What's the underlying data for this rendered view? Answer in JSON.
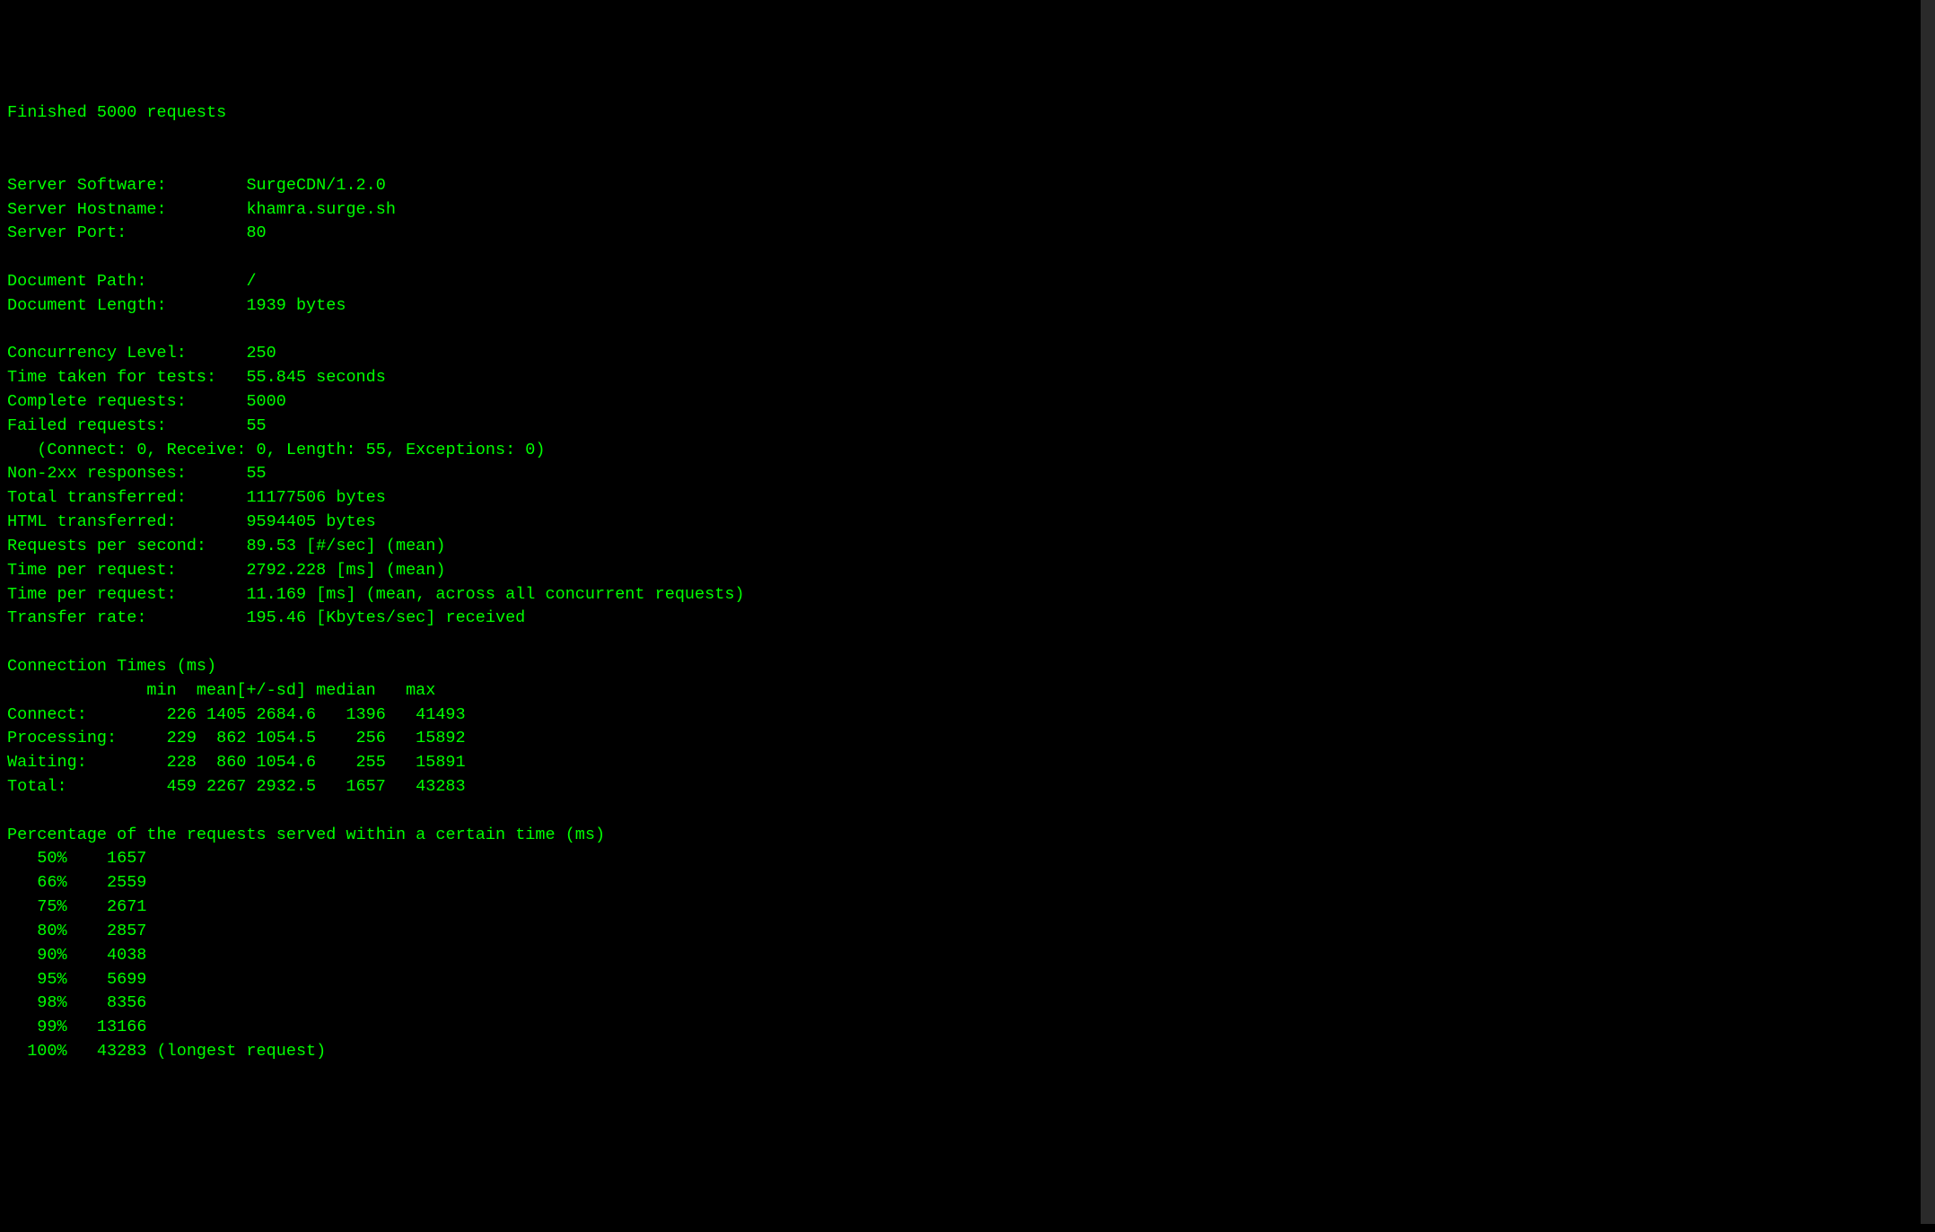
{
  "header": {
    "finished_line": "Finished 5000 requests"
  },
  "server": {
    "software_label": "Server Software:",
    "software_value": "SurgeCDN/1.2.0",
    "hostname_label": "Server Hostname:",
    "hostname_value": "khamra.surge.sh",
    "port_label": "Server Port:",
    "port_value": "80"
  },
  "document": {
    "path_label": "Document Path:",
    "path_value": "/",
    "length_label": "Document Length:",
    "length_value": "1939 bytes"
  },
  "stats": {
    "concurrency_label": "Concurrency Level:",
    "concurrency_value": "250",
    "time_taken_label": "Time taken for tests:",
    "time_taken_value": "55.845 seconds",
    "complete_label": "Complete requests:",
    "complete_value": "5000",
    "failed_label": "Failed requests:",
    "failed_value": "55",
    "failed_breakdown": "   (Connect: 0, Receive: 0, Length: 55, Exceptions: 0)",
    "non2xx_label": "Non-2xx responses:",
    "non2xx_value": "55",
    "total_transferred_label": "Total transferred:",
    "total_transferred_value": "11177506 bytes",
    "html_transferred_label": "HTML transferred:",
    "html_transferred_value": "9594405 bytes",
    "rps_label": "Requests per second:",
    "rps_value": "89.53 [#/sec] (mean)",
    "tpr1_label": "Time per request:",
    "tpr1_value": "2792.228 [ms] (mean)",
    "tpr2_label": "Time per request:",
    "tpr2_value": "11.169 [ms] (mean, across all concurrent requests)",
    "transfer_rate_label": "Transfer rate:",
    "transfer_rate_value": "195.46 [Kbytes/sec] received"
  },
  "connection_times": {
    "heading": "Connection Times (ms)",
    "header_row": "              min  mean[+/-sd] median   max",
    "rows": [
      {
        "name": "Connect:",
        "min": "226",
        "mean": "1405",
        "sd": "2684.6",
        "median": "1396",
        "max": "41493"
      },
      {
        "name": "Processing:",
        "min": "229",
        "mean": "862",
        "sd": "1054.5",
        "median": "256",
        "max": "15892"
      },
      {
        "name": "Waiting:",
        "min": "228",
        "mean": "860",
        "sd": "1054.6",
        "median": "255",
        "max": "15891"
      },
      {
        "name": "Total:",
        "min": "459",
        "mean": "2267",
        "sd": "2932.5",
        "median": "1657",
        "max": "43283"
      }
    ]
  },
  "percentiles": {
    "heading": "Percentage of the requests served within a certain time (ms)",
    "rows": [
      {
        "pct": "50%",
        "val": "1657",
        "note": ""
      },
      {
        "pct": "66%",
        "val": "2559",
        "note": ""
      },
      {
        "pct": "75%",
        "val": "2671",
        "note": ""
      },
      {
        "pct": "80%",
        "val": "2857",
        "note": ""
      },
      {
        "pct": "90%",
        "val": "4038",
        "note": ""
      },
      {
        "pct": "95%",
        "val": "5699",
        "note": ""
      },
      {
        "pct": "98%",
        "val": "8356",
        "note": ""
      },
      {
        "pct": "99%",
        "val": "13166",
        "note": ""
      },
      {
        "pct": "100%",
        "val": "43283",
        "note": "(longest request)"
      }
    ]
  }
}
